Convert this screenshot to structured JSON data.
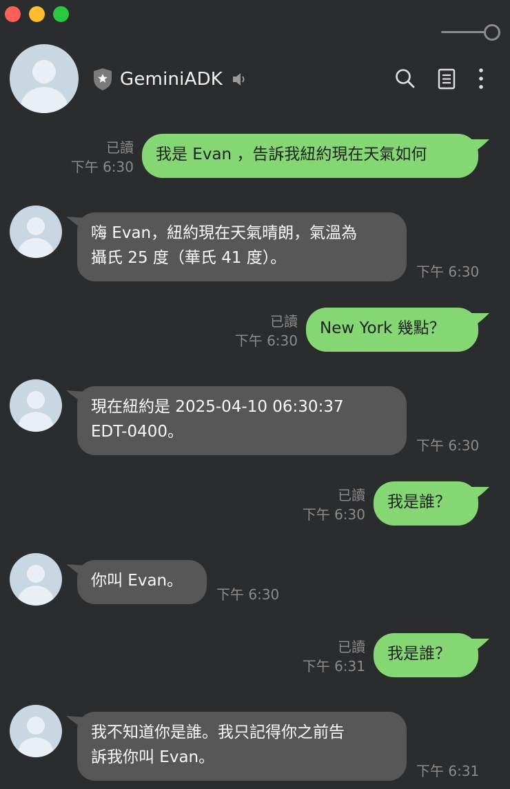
{
  "window": {
    "traffic_lights": [
      "close",
      "minimize",
      "maximize"
    ]
  },
  "header": {
    "title": "GeminiADK",
    "icons": [
      "shield-icon",
      "speaker-icon",
      "search-icon",
      "notes-icon",
      "more-icon"
    ]
  },
  "colors": {
    "background": "#2b2c2e",
    "outgoing_bubble": "#85d773",
    "incoming_bubble": "#575757",
    "meta_text": "#8c8c8c"
  },
  "messages": [
    {
      "dir": "out",
      "text": "我是 Evan ，告訴我紐約現在天氣如何",
      "read": "已讀",
      "time": "下午 6:30"
    },
    {
      "dir": "in",
      "line1": "嗨 Evan，紐約現在天氣晴朗，氣溫為",
      "line2": "攝氏 25 度（華氏 41 度）。",
      "time": "下午 6:30"
    },
    {
      "dir": "out",
      "text": "New York 幾點？",
      "read": "已讀",
      "time": "下午 6:30"
    },
    {
      "dir": "in",
      "line1": "現在紐約是 2025-04-10 06:30:37",
      "line2": "EDT-0400。",
      "time": "下午 6:30"
    },
    {
      "dir": "out",
      "text": "我是誰？",
      "read": "已讀",
      "time": "下午 6:30"
    },
    {
      "dir": "in",
      "text": "你叫 Evan。",
      "time": "下午 6:30"
    },
    {
      "dir": "out",
      "text": "我是誰？",
      "read": "已讀",
      "time": "下午 6:31"
    },
    {
      "dir": "in",
      "line1": "我不知道你是誰。我只記得你之前告",
      "line2": "訴我你叫 Evan。",
      "time": "下午 6:31"
    }
  ]
}
